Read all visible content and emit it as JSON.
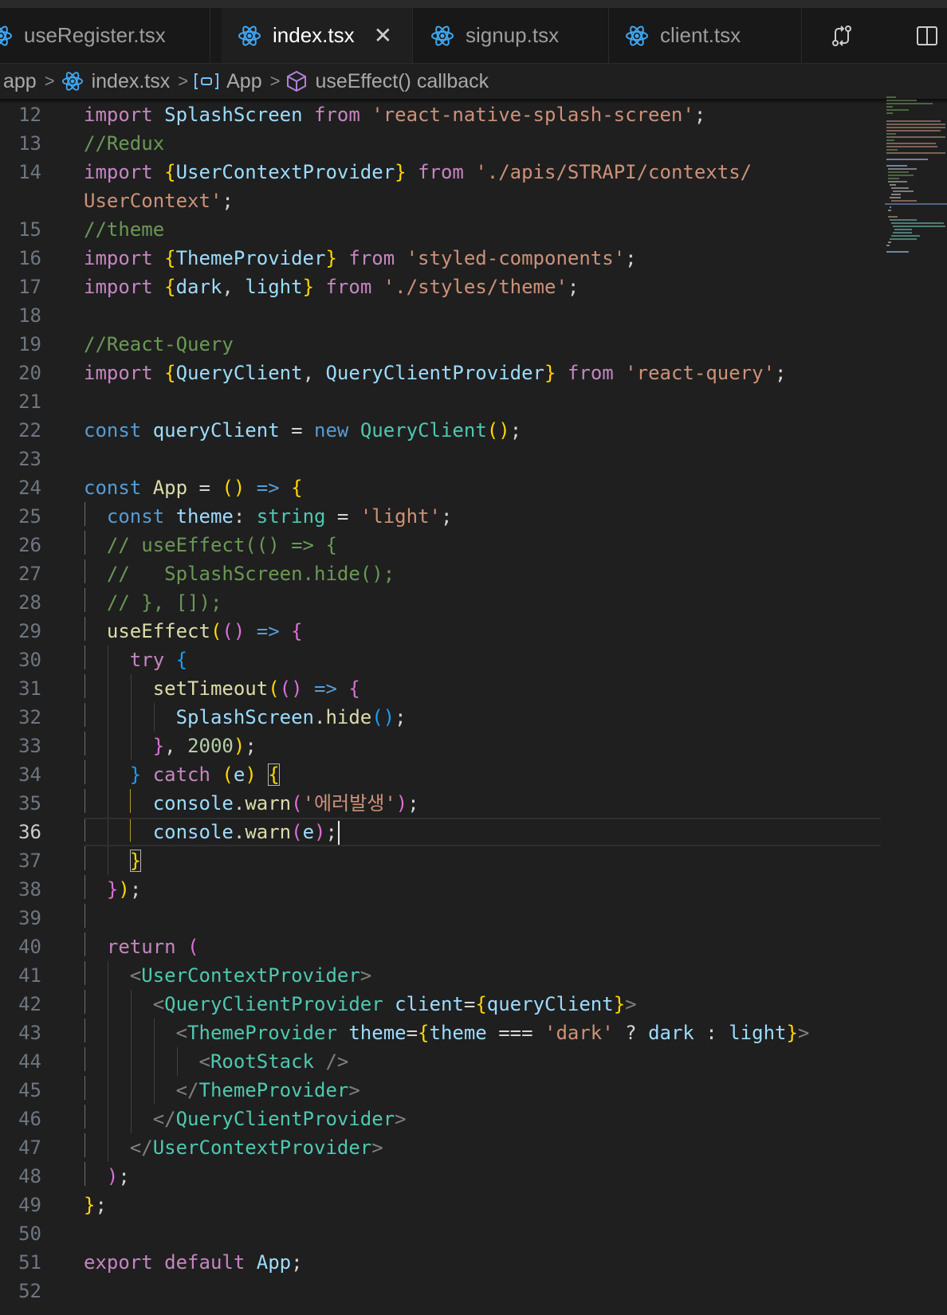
{
  "tabs": [
    {
      "label": "useRegister.tsx",
      "active": false,
      "icon": "react-icon"
    },
    {
      "label": "index.tsx",
      "active": true,
      "icon": "react-icon"
    },
    {
      "label": "signup.tsx",
      "active": false,
      "icon": "react-icon"
    },
    {
      "label": "client.tsx",
      "active": false,
      "icon": "react-icon"
    }
  ],
  "breadcrumb": {
    "folder": "app",
    "file": "index.tsx",
    "symbol": "App",
    "callback": "useEffect() callback"
  },
  "editor": {
    "current_line": "36",
    "lines": [
      {
        "n": "12"
      },
      {
        "n": "13"
      },
      {
        "n": "14"
      },
      {
        "n": ""
      },
      {
        "n": "15"
      },
      {
        "n": "16"
      },
      {
        "n": "17"
      },
      {
        "n": "18"
      },
      {
        "n": "19"
      },
      {
        "n": "20"
      },
      {
        "n": "21"
      },
      {
        "n": "22"
      },
      {
        "n": "23"
      },
      {
        "n": "24"
      },
      {
        "n": "25"
      },
      {
        "n": "26"
      },
      {
        "n": "27"
      },
      {
        "n": "28"
      },
      {
        "n": "29"
      },
      {
        "n": "30"
      },
      {
        "n": "31"
      },
      {
        "n": "32"
      },
      {
        "n": "33"
      },
      {
        "n": "34"
      },
      {
        "n": "35"
      },
      {
        "n": "36"
      },
      {
        "n": "37"
      },
      {
        "n": "38"
      },
      {
        "n": "39"
      },
      {
        "n": "40"
      },
      {
        "n": "41"
      },
      {
        "n": "42"
      },
      {
        "n": "43"
      },
      {
        "n": "44"
      },
      {
        "n": "45"
      },
      {
        "n": "46"
      },
      {
        "n": "47"
      },
      {
        "n": "48"
      },
      {
        "n": "49"
      },
      {
        "n": "50"
      },
      {
        "n": "51"
      },
      {
        "n": "52"
      }
    ]
  },
  "colors": {
    "background": "#1f1f1f",
    "keyword": "#569cd6",
    "control": "#c586c0",
    "string": "#ce9178",
    "comment": "#6a9955",
    "function": "#dcdcaa",
    "component": "#4ec9b0",
    "react_icon": "#3fa8f4"
  }
}
